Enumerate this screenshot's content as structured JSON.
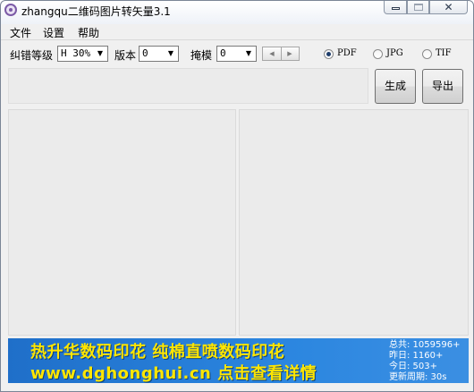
{
  "window": {
    "title": "zhangqu二维码图片转矢量3.1",
    "controls": {
      "close_glyph": "✕"
    }
  },
  "menu": {
    "items": [
      "文件",
      "设置",
      "帮助"
    ]
  },
  "toolbar": {
    "ecc_label": "纠错等级",
    "ecc_value": "H 30%",
    "version_label": "版本",
    "version_value": "0",
    "mask_label": "掩模",
    "mask_value": "0",
    "format_options": [
      {
        "label": "PDF",
        "checked": true
      },
      {
        "label": "JPG",
        "checked": false
      },
      {
        "label": "TIF",
        "checked": false
      }
    ]
  },
  "actions": {
    "generate_label": "生成",
    "export_label": "导出"
  },
  "banner": {
    "line1": "热升华数码印花 纯棉直喷数码印花",
    "line2": "www.dghonghui.cn 点击查看详情",
    "stats": {
      "total": "总共: 1059596+",
      "yesterday": "昨日: 1160+",
      "today": "今日: 503+",
      "period": "更新周期: 30s"
    }
  },
  "icons": {
    "app": "qr-app-icon",
    "spin_left": "triangle-left-icon",
    "spin_right": "triangle-right-icon",
    "dropdown": "chevron-down-icon"
  }
}
